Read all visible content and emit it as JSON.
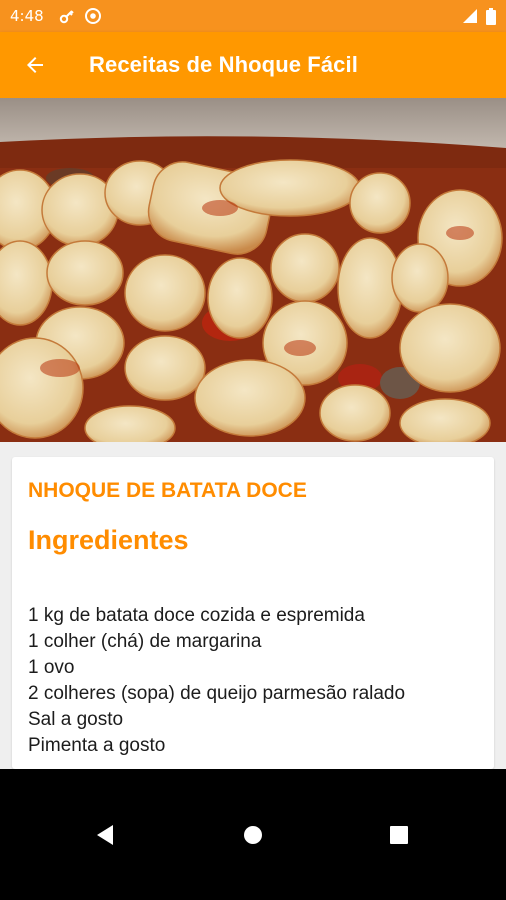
{
  "status_bar": {
    "time": "4:48",
    "icons": [
      "key-icon",
      "data-saver-icon",
      "signal-icon",
      "battery-icon"
    ]
  },
  "app_bar": {
    "title": "Receitas de Nhoque Fácil",
    "back_icon": "arrow-back-icon"
  },
  "colors": {
    "primary": "#ff9800",
    "primary_dark": "#f7921e",
    "accent_text": "#ff8c00"
  },
  "recipe": {
    "title": "NHOQUE DE BATATA DOCE",
    "section_title": "Ingredientes",
    "ingredients": [
      "1 kg de batata doce cozida e espremida",
      "1 colher (chá) de margarina",
      "1 ovo",
      "2 colheres (sopa) de queijo parmesão ralado",
      "Sal a gosto",
      "Pimenta a gosto"
    ]
  },
  "nav_bar": {
    "buttons": [
      "back-triangle-icon",
      "home-circle-icon",
      "recents-square-icon"
    ]
  }
}
